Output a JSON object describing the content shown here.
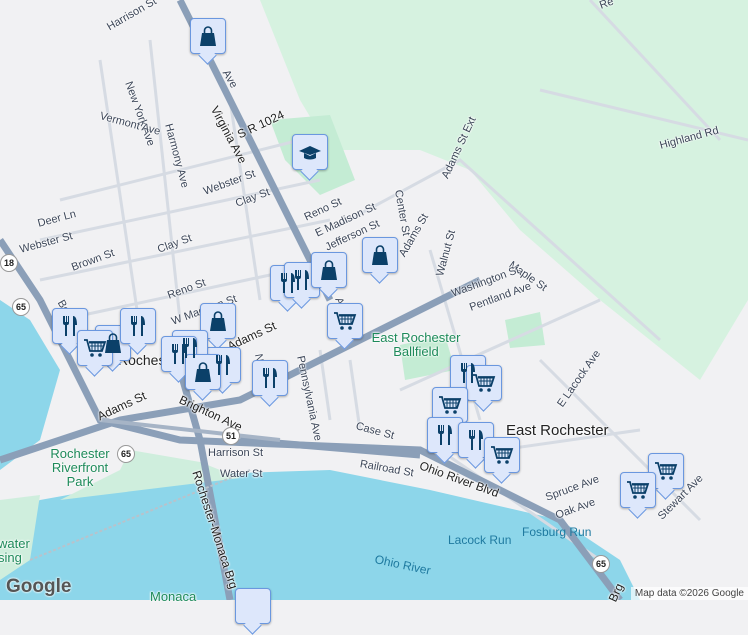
{
  "streets": [
    "Harrison St",
    "New York Ave",
    "Vermont Ave",
    "Harmony Ave",
    "Virginia Ave",
    "S R 1024",
    "Webster St",
    "Clay St",
    "Deer Ln",
    "Webster St",
    "Clay St",
    "Brown St",
    "Reno St",
    "Reno St",
    "E Madison St",
    "Jefferson St",
    "W Madison St",
    "Adams St",
    "Adams St",
    "Center St",
    "Adams St Ext",
    "Adams St",
    "Walnut St",
    "Maple St",
    "Washington St",
    "Pentland Ave",
    "Highland Rd",
    "Pennsylvania Ave",
    "New",
    "Brighton Ave",
    "Harrison St",
    "Water St",
    "Case St",
    "Railroad St",
    "Ohio River Blvd",
    "E Lacock Ave",
    "Spruce Ave",
    "Oak Ave",
    "Stewart Ave",
    "Rochester-Monaca Brg",
    "Brg",
    "Bedford",
    "Ave",
    "Ave",
    "Re"
  ],
  "places": {
    "town1": "Rochester",
    "town2": "East Rochester",
    "park1": "East Rochester Ballfield",
    "park2": "Rochester Riverfront Park",
    "park3": "water sing",
    "water1": "Ohio River",
    "water2": "Lacock Run",
    "water3": "Fosburg Run",
    "monaca": "Monaca"
  },
  "shields": [
    "18",
    "65",
    "65",
    "51",
    "65"
  ],
  "footer": {
    "logo": "Google",
    "attribution": "Map data ©2026 Google"
  },
  "colors": {
    "marker_bg": "#dde7fb",
    "marker_border": "#6a97df",
    "icon": "#0b4069",
    "water": "#8dd6ea",
    "park": "#cfeedd"
  }
}
